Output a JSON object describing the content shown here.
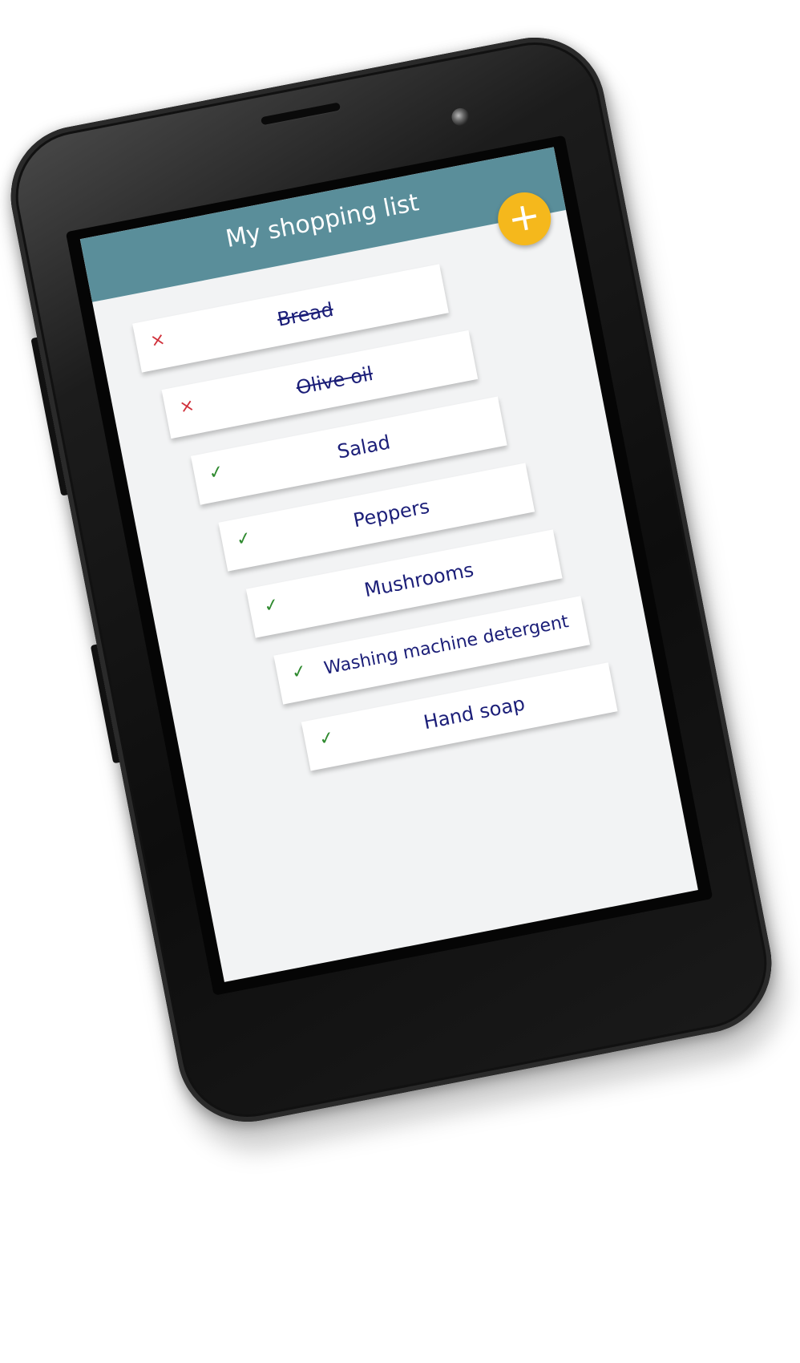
{
  "app": {
    "title": "My shopping list",
    "add_button": "+"
  },
  "colors": {
    "app_bar": "#5a8e9a",
    "fab": "#f5b81c",
    "item_text": "#1b1e78",
    "remove_mark": "#d0303a",
    "check_mark": "#2f8a2f"
  },
  "items": [
    {
      "name": "Bread",
      "mark": "×",
      "state": "crossed-out"
    },
    {
      "name": "Olive oil",
      "mark": "×",
      "state": "crossed-out"
    },
    {
      "name": "Salad",
      "mark": "✓",
      "state": "active"
    },
    {
      "name": "Peppers",
      "mark": "✓",
      "state": "active"
    },
    {
      "name": "Mushrooms",
      "mark": "✓",
      "state": "active"
    },
    {
      "name": "Washing machine detergent",
      "mark": "✓",
      "state": "active"
    },
    {
      "name": "Hand soap",
      "mark": "✓",
      "state": "active"
    }
  ]
}
